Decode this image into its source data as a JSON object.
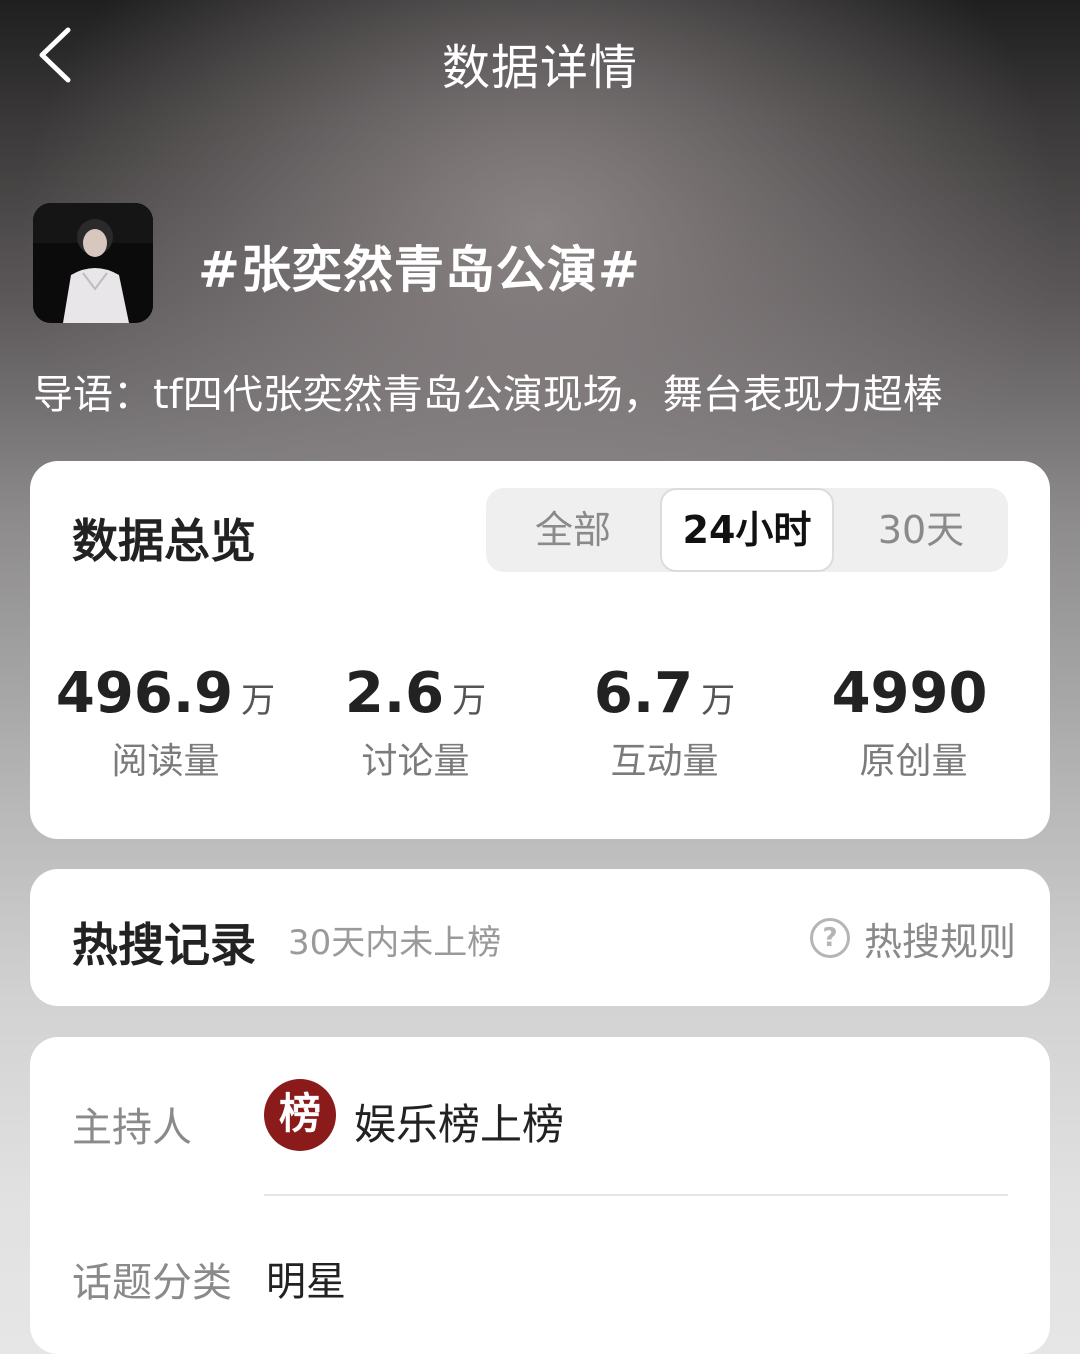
{
  "header": {
    "title": "数据详情",
    "back_icon": "back-arrow-icon"
  },
  "topic": {
    "title": "#张奕然青岛公演#",
    "intro": "导语：tf四代张奕然青岛公演现场，舞台表现力超棒",
    "thumbnail": "topic-cover-image"
  },
  "overview": {
    "heading": "数据总览",
    "tabs": [
      "全部",
      "24小时",
      "30天"
    ],
    "selected_tab": "24小时",
    "stats": [
      {
        "value": "496.9",
        "unit": "万",
        "label": "阅读量"
      },
      {
        "value": "2.6",
        "unit": "万",
        "label": "讨论量"
      },
      {
        "value": "6.7",
        "unit": "万",
        "label": "互动量"
      },
      {
        "value": "4990",
        "unit": "",
        "label": "原创量"
      }
    ]
  },
  "hot_search": {
    "heading": "热搜记录",
    "subtitle": "30天内未上榜",
    "rule_label": "热搜规则",
    "rule_icon": "question-circle-icon"
  },
  "info": {
    "host_label": "主持人",
    "host_avatar_char": "榜",
    "host_name": "娱乐榜上榜",
    "category_label": "话题分类",
    "category_value": "明星"
  },
  "colors": {
    "accent_avatar": "#8b1a1a",
    "card_bg": "#ffffff"
  }
}
